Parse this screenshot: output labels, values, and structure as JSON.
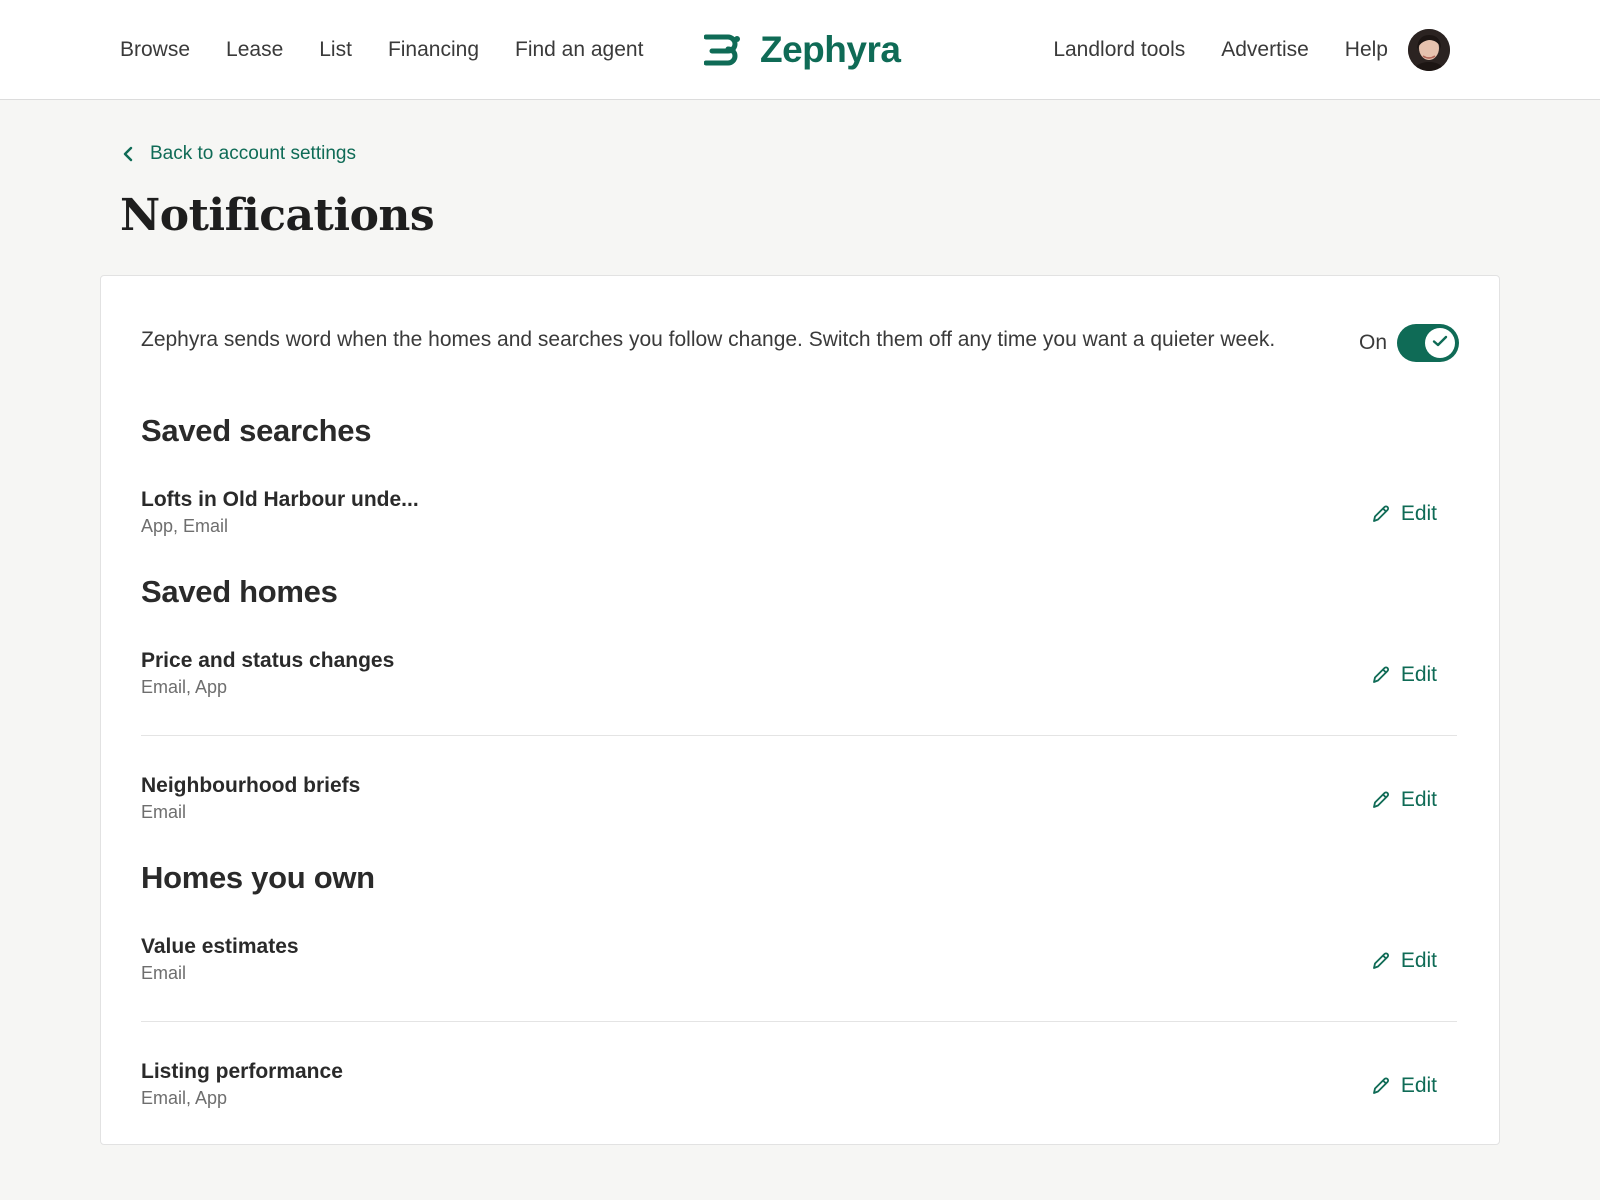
{
  "nav": {
    "left_links": [
      "Browse",
      "Lease",
      "List",
      "Financing",
      "Find an agent"
    ],
    "brand": "Zephyra",
    "right_links": [
      "Landlord tools",
      "Advertise",
      "Help"
    ]
  },
  "back_link": "Back to account settings",
  "page_title": "Notifications",
  "intro": {
    "text": "Zephyra sends word when the homes and searches you follow change. Switch them off any time you want a quieter week.",
    "toggle_label": "On",
    "toggle_on": true
  },
  "sections": {
    "saved_searches": {
      "heading": "Saved searches",
      "items": [
        {
          "title": "Lofts in Old Harbour unde...",
          "channels": "App, Email",
          "edit": "Edit"
        }
      ]
    },
    "saved_homes": {
      "heading": "Saved homes",
      "items": [
        {
          "title": "Price and status changes",
          "channels": "Email, App",
          "edit": "Edit"
        },
        {
          "title": "Neighbourhood briefs",
          "channels": "Email",
          "edit": "Edit"
        }
      ]
    },
    "homes_you_own": {
      "heading": "Homes you own",
      "items": [
        {
          "title": "Value estimates",
          "channels": "Email",
          "edit": "Edit"
        },
        {
          "title": "Listing performance",
          "channels": "Email, App",
          "edit": "Edit"
        }
      ]
    }
  },
  "colors": {
    "accent": "#0f6b56",
    "page_bg": "#f6f6f4",
    "card_bg": "#ffffff",
    "muted_text": "#6e6e6e"
  },
  "icons": [
    "logo-mark-icon",
    "avatar-photo",
    "chevron-left-icon",
    "check-icon",
    "pencil-icon"
  ]
}
